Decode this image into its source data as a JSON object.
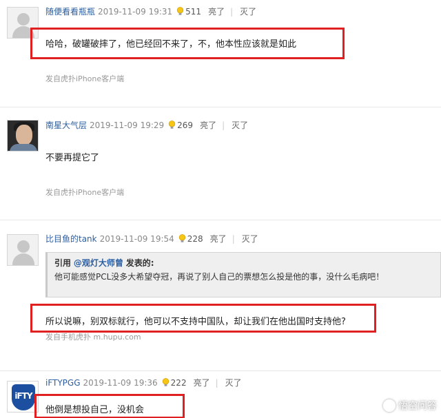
{
  "actions": {
    "like": "亮了",
    "dislike": "灭了",
    "separator": "|"
  },
  "posts": [
    {
      "user": "随便看看瓶瓶",
      "time": "2019-11-09 19:31",
      "likes": "511",
      "content": "哈哈，破罐破摔了，他已经回不来了，不，他本性应该就是如此",
      "source": "发自虎扑iPhone客户端",
      "avatar_icon": "default-avatar"
    },
    {
      "user": "南星大气层",
      "time": "2019-11-09 19:29",
      "likes": "269",
      "content": "不要再提它了",
      "source": "发自虎扑iPhone客户端",
      "avatar_icon": "photo-avatar"
    },
    {
      "user": "比目鱼的tank",
      "time": "2019-11-09 19:54",
      "likes": "228",
      "quote": {
        "prefix": "引用",
        "user": "@观灯大师曾",
        "suffix": "发表的:",
        "text": "他可能感觉PCL没多大希望夺冠，再说了别人自己的票想怎么投是他的事，没什么毛病吧！"
      },
      "content": "所以说嘛，别双标就行，他可以不支持中国队，却让我们在他出国时支持他?",
      "source": "发自手机虎扑 m.hupu.com",
      "avatar_icon": "default-avatar"
    },
    {
      "user": "iFTYPGG",
      "time": "2019-11-09 19:36",
      "likes": "222",
      "content": "他倒是想投自己，没机会",
      "avatar_icon": "ifty-logo-avatar",
      "avatar_text": "iFTY"
    }
  ],
  "watermark": {
    "text": "悟空问答",
    "icon": "wukong-logo-icon"
  },
  "colors": {
    "highlight": "#e02020",
    "username": "#2c5ea0",
    "quote_bg": "#efefef"
  }
}
